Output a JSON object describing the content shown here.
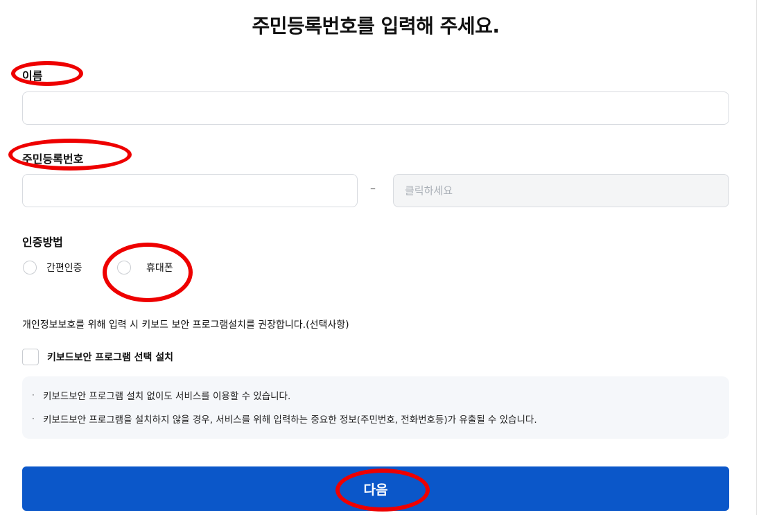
{
  "page": {
    "title": "주민등록번호를 입력해 주세요."
  },
  "form": {
    "name_label": "이름",
    "name_value": "",
    "rrn_label": "주민등록번호",
    "rrn_front_value": "",
    "rrn_separator": "–",
    "rrn_back_placeholder": "클릭하세요",
    "auth_label": "인증방법",
    "auth_options": [
      {
        "label": "간편인증",
        "selected": false
      },
      {
        "label": "휴대폰",
        "selected": false
      }
    ]
  },
  "security": {
    "notice": "개인정보보호를 위해 입력 시 키보드 보안 프로그램설치를 권장합니다.(선택사항)",
    "checkbox_label": "키보드보안 프로그램 선택 설치",
    "checkbox_checked": false,
    "bullet_glyph": "·",
    "info": [
      "키보드보안 프로그램 설치 없이도 서비스를 이용할 수 있습니다.",
      "키보드보안 프로그램을 설치하지 않을 경우, 서비스를 위해 입력하는 중요한 정보(주민번호, 전화번호등)가 유출될 수 있습니다."
    ]
  },
  "actions": {
    "next_label": "다음"
  },
  "colors": {
    "primary_button": "#0b57c9",
    "annotation_red": "#ee0000",
    "info_background": "#f5f7fa",
    "input_border": "#d8dbe0"
  }
}
